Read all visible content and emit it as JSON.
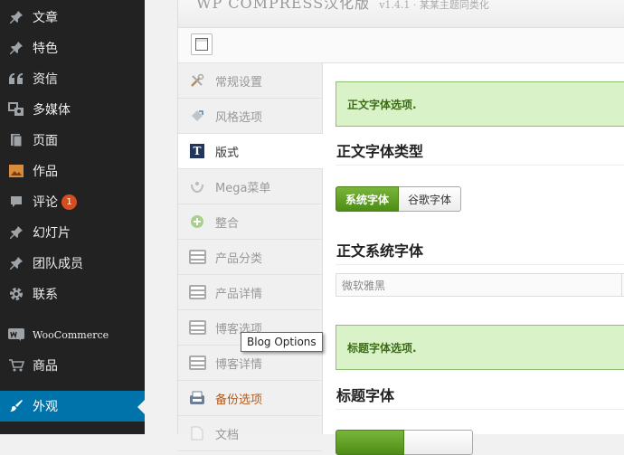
{
  "admin_menu": {
    "items": [
      {
        "label": "文章",
        "icon": "pin-icon"
      },
      {
        "label": "特色",
        "icon": "pin-icon"
      },
      {
        "label": "资信",
        "icon": "quote-icon"
      },
      {
        "label": "多媒体",
        "icon": "media-icon"
      },
      {
        "label": "页面",
        "icon": "pages-icon"
      },
      {
        "label": "作品",
        "icon": "portfolio-icon"
      },
      {
        "label": "评论",
        "icon": "comment-icon",
        "badge": "1"
      },
      {
        "label": "幻灯片",
        "icon": "pin-icon"
      },
      {
        "label": "团队成员",
        "icon": "pin-icon"
      },
      {
        "label": "联系",
        "icon": "gear-icon"
      },
      {
        "label": "WooCommerce",
        "icon": "woo-icon"
      },
      {
        "label": "商品",
        "icon": "cart-icon"
      },
      {
        "label": "外观",
        "icon": "brush-icon",
        "active": true
      }
    ]
  },
  "header": {
    "title": "WP COMPRESS汉化版",
    "version": "v1.4.1 · 某某主题同类化"
  },
  "tabs": [
    {
      "label": "常规设置",
      "icon": "tools-icon"
    },
    {
      "label": "风格选项",
      "icon": "paint-bucket-icon"
    },
    {
      "label": "版式",
      "icon": "typography-icon",
      "icon_text": "T",
      "active": true
    },
    {
      "label": "Mega菜单",
      "icon": "mega-menu-icon"
    },
    {
      "label": "整合",
      "icon": "plus-circle-icon"
    },
    {
      "label": "产品分类",
      "icon": "list-icon"
    },
    {
      "label": "产品详情",
      "icon": "list-icon"
    },
    {
      "label": "博客选项",
      "icon": "list-icon"
    },
    {
      "label": "博客详情",
      "icon": "list-icon"
    },
    {
      "label": "备份选项",
      "icon": "backup-icon"
    },
    {
      "label": "文档",
      "icon": "document-icon"
    }
  ],
  "content": {
    "body_notice": "正文字体选项.",
    "body_font_type_heading": "正文字体类型",
    "font_type_options": [
      "系统字体",
      "谷歌字体"
    ],
    "font_type_selected": "系统字体",
    "body_system_font_heading": "正文系统字体",
    "body_system_font_value": "微软雅黑",
    "heading_notice": "标题字体选项.",
    "heading_font_heading": "标题字体"
  },
  "tooltip": "Blog Options",
  "colors": {
    "admin_bg": "#222222",
    "admin_active": "#0073aa",
    "notice_bg": "#d9f2c8",
    "button_green": "#5a9a1f",
    "badge": "#d54e21"
  }
}
